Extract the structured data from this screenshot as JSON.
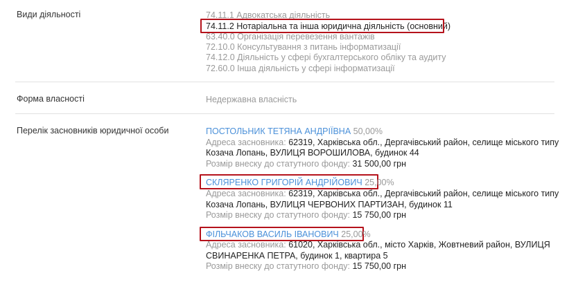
{
  "activities": {
    "label": "Види діяльності",
    "items": [
      "74.11.1 Адвокатська діяльність",
      "74.11.2 Нотаріальна та інша юридична діяльність (основний)",
      "63.40.0 Організація перевезення вантажів",
      "72.10.0 Консультування з питань інформатизації",
      "74.12.0 Діяльність у сфері бухгалтерського обліку та аудиту",
      "72.60.0 Інша діяльність у сфері інформатизації"
    ]
  },
  "ownership": {
    "label": "Форма власності",
    "value": "Недержавна власність"
  },
  "founders": {
    "label": "Перелік засновників юридичної особи",
    "address_label": "Адреса засновника:",
    "contribution_label": "Розмір внеску до статутного фонду:",
    "items": [
      {
        "name": "ПОСТОЛЬНИК ТЕТЯНА АНДРІЇВНА",
        "share": "50,00%",
        "address_line1": "62319, Харківська обл., Дергачівський район, селище міського типу",
        "address_line2": "Козача Лопань, ВУЛИЦЯ ВОРОШИЛОВА, будинок 44",
        "contribution": "31 500,00 грн"
      },
      {
        "name": "СКЛЯРЕНКО ГРИГОРІЙ АНДРІЙОВИЧ",
        "share": "25,00%",
        "address_line1": "62319, Харківська обл., Дергачівський район, селище міського типу",
        "address_line2": "Козача Лопань, ВУЛИЦЯ ЧЕРВОНИХ ПАРТИЗАН, будинок 11",
        "contribution": "15 750,00 грн"
      },
      {
        "name": "ФІЛЬЧАКОВ ВАСИЛЬ ІВАНОВИЧ",
        "share": "25,00%",
        "address_line1": "61020, Харківська обл., місто Харків, Жовтневий район, ВУЛИЦЯ",
        "address_line2": "СВИНАРЕНКА ПЕТРА, будинок 1, квартира 5",
        "contribution": "15 750,00 грн"
      }
    ]
  }
}
